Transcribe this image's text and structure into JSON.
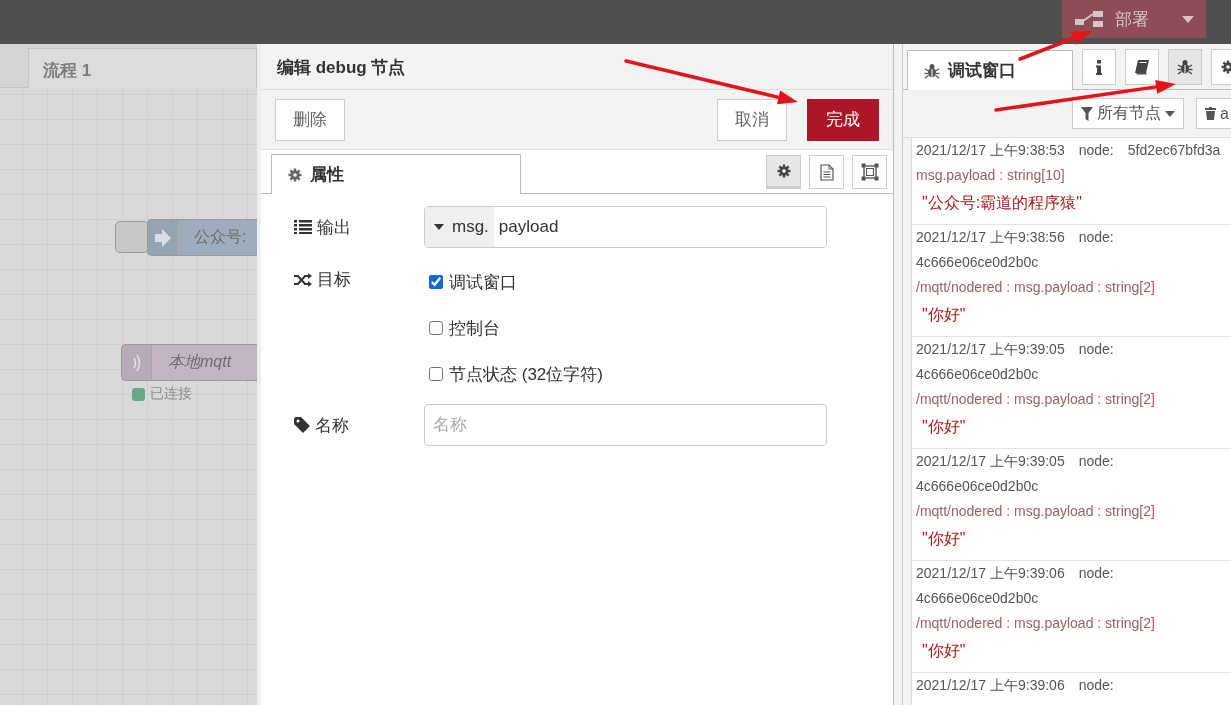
{
  "header": {
    "deploy_button": {
      "label": "部署"
    }
  },
  "workspace": {
    "tabs": [
      {
        "label": "流程 1",
        "selected": true
      }
    ],
    "nodes": [
      {
        "kind": "inject",
        "label": "公众号:"
      },
      {
        "kind": "mqtt",
        "label": "本地mqtt",
        "status": "已连接",
        "color": "#66a88a"
      }
    ]
  },
  "editor": {
    "title": "编辑 debug 节点",
    "buttons": [
      {
        "label": "删除",
        "kind": "plain"
      },
      {
        "label": "取消",
        "kind": "plain"
      },
      {
        "label": "完成",
        "kind": "primary"
      }
    ],
    "tabs": [
      {
        "label": "属性",
        "selected": true
      }
    ],
    "tab_tools": [
      {
        "kind": "settings",
        "selected": true
      },
      {
        "kind": "document",
        "selected": false
      },
      {
        "kind": "frame",
        "selected": false
      }
    ],
    "output": {
      "label": "输出",
      "prefix": "msg.",
      "value": "payload"
    },
    "target": {
      "label": "目标",
      "options": [
        {
          "label": "调试窗口",
          "checked": true
        },
        {
          "label": "控制台",
          "checked": false
        },
        {
          "label": "节点状态 (32位字符)",
          "checked": false
        }
      ]
    },
    "name": {
      "label": "名称",
      "placeholder": "名称"
    }
  },
  "sidebar": {
    "tabs": [
      {
        "label": "调试窗口",
        "selected": true
      }
    ],
    "tab_buttons": [
      {
        "kind": "info",
        "selected": false
      },
      {
        "kind": "book",
        "selected": false
      },
      {
        "kind": "bug",
        "selected": true
      },
      {
        "kind": "settings",
        "selected": false
      }
    ],
    "filter_button": {
      "label": "所有节点"
    },
    "clear_button": {
      "label": "a"
    },
    "messages": [
      {
        "time": "2021/12/17 上午9:38:53",
        "node_label": "node:",
        "node_id": "5fd2ec67bfd3a",
        "topic": "msg.payload : string[10]",
        "value": "\"公众号:霸道的程序猿\""
      },
      {
        "time": "2021/12/17 上午9:38:56",
        "node_label": "node:",
        "node_id": "4c666e06ce0d2b0c",
        "topic": "/mqtt/nodered : msg.payload : string[2]",
        "value": "\"你好\""
      },
      {
        "time": "2021/12/17 上午9:39:05",
        "node_label": "node:",
        "node_id": "4c666e06ce0d2b0c",
        "topic": "/mqtt/nodered : msg.payload : string[2]",
        "value": "\"你好\""
      },
      {
        "time": "2021/12/17 上午9:39:05",
        "node_label": "node:",
        "node_id": "4c666e06ce0d2b0c",
        "topic": "/mqtt/nodered : msg.payload : string[2]",
        "value": "\"你好\""
      },
      {
        "time": "2021/12/17 上午9:39:06",
        "node_label": "node:",
        "node_id": "4c666e06ce0d2b0c",
        "topic": "/mqtt/nodered : msg.payload : string[2]",
        "value": "\"你好\""
      },
      {
        "time": "2021/12/17 上午9:39:06",
        "node_label": "node:"
      }
    ]
  }
}
